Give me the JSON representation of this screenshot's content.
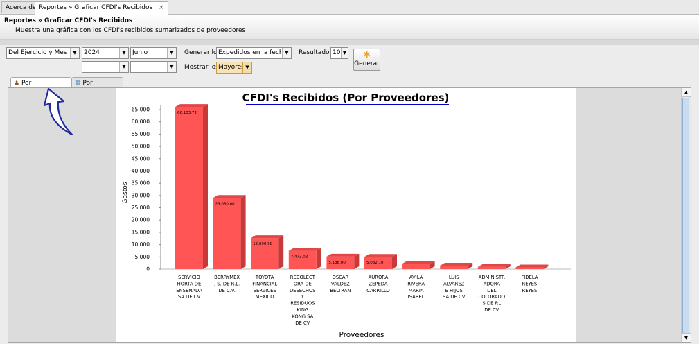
{
  "tabs": [
    {
      "label": "Acerca de"
    },
    {
      "label": "Reportes » Graficar CFDI's Recibidos",
      "close": "×"
    }
  ],
  "header": {
    "title": "Reportes » Graficar CFDI's Recibidos",
    "subtitle": "Muestra una gráfica con los CFDI's recibidos sumarizados de proveedores"
  },
  "filters": {
    "period_type": "Del Ejercicio y Mes",
    "year": "2024",
    "month": "Junio",
    "date_from": "",
    "date_to": "",
    "generate_label": "Generar los",
    "generate_value": "Expedidos en la fecha",
    "results_label": "Resultados",
    "results_value": "10",
    "show_label": "Mostrar los",
    "show_value": "Mayores",
    "button_label": "Generar",
    "button_icon": "sparkle-icon"
  },
  "subtabs": [
    {
      "label": "Por Proveedores",
      "icon": "user-icon"
    },
    {
      "label": "Por Producto",
      "icon": "grid-icon"
    }
  ],
  "colors": {
    "bar": "#ff5555",
    "bar_dark": "#c83a3a",
    "underline": "#0000cc"
  },
  "chart_data": {
    "type": "bar",
    "title": "CFDI's Recibidos (Por Proveedores)",
    "xlabel": "Proveedores",
    "ylabel": "Gastos",
    "ylim": [
      0,
      65000
    ],
    "yticks": [
      "0",
      "5,000",
      "10,000",
      "15,000",
      "20,000",
      "25,000",
      "30,000",
      "35,000",
      "40,000",
      "45,000",
      "50,000",
      "55,000",
      "60,000",
      "65,000"
    ],
    "categories": [
      [
        "SERVICIO",
        "HORTA DE",
        "ENSENADA",
        "SA DE CV"
      ],
      [
        "BERRYMEX",
        ", S. DE R.L.",
        "DE C.V."
      ],
      [
        "TOYOTA",
        "FINANCIAL",
        "SERVICES",
        "MEXICO"
      ],
      [
        "RECOLECT",
        "ORA DE",
        "DESECHOS",
        "Y",
        "RESIDUOS",
        "KING",
        "KONG SA",
        "DE CV"
      ],
      [
        "OSCAR",
        "VALDEZ",
        "BELTRAN"
      ],
      [
        "AURORA",
        "ZEPEDA",
        "CARRILLO"
      ],
      [
        "AVILA",
        "RIVERA",
        "MARIA",
        "ISABEL"
      ],
      [
        "LUIS",
        "ALVAREZ",
        "E HIJOS",
        "SA DE CV"
      ],
      [
        "ADMINISTR",
        "ADORA",
        "DEL",
        "COLORADO",
        "S DE RL",
        "DE CV"
      ],
      [
        "FIDELA",
        "REYES",
        "REYES"
      ]
    ],
    "values": [
      66103.72,
      29030.0,
      12690.98,
      7473.02,
      5136.0,
      5032.1,
      2200,
      1400,
      900,
      700
    ],
    "data_labels": [
      "66,103.72",
      "29,030.00",
      "12,690.98",
      "7,473.02",
      "5,136.00",
      "5,032.10",
      "",
      "",
      "",
      ""
    ]
  }
}
